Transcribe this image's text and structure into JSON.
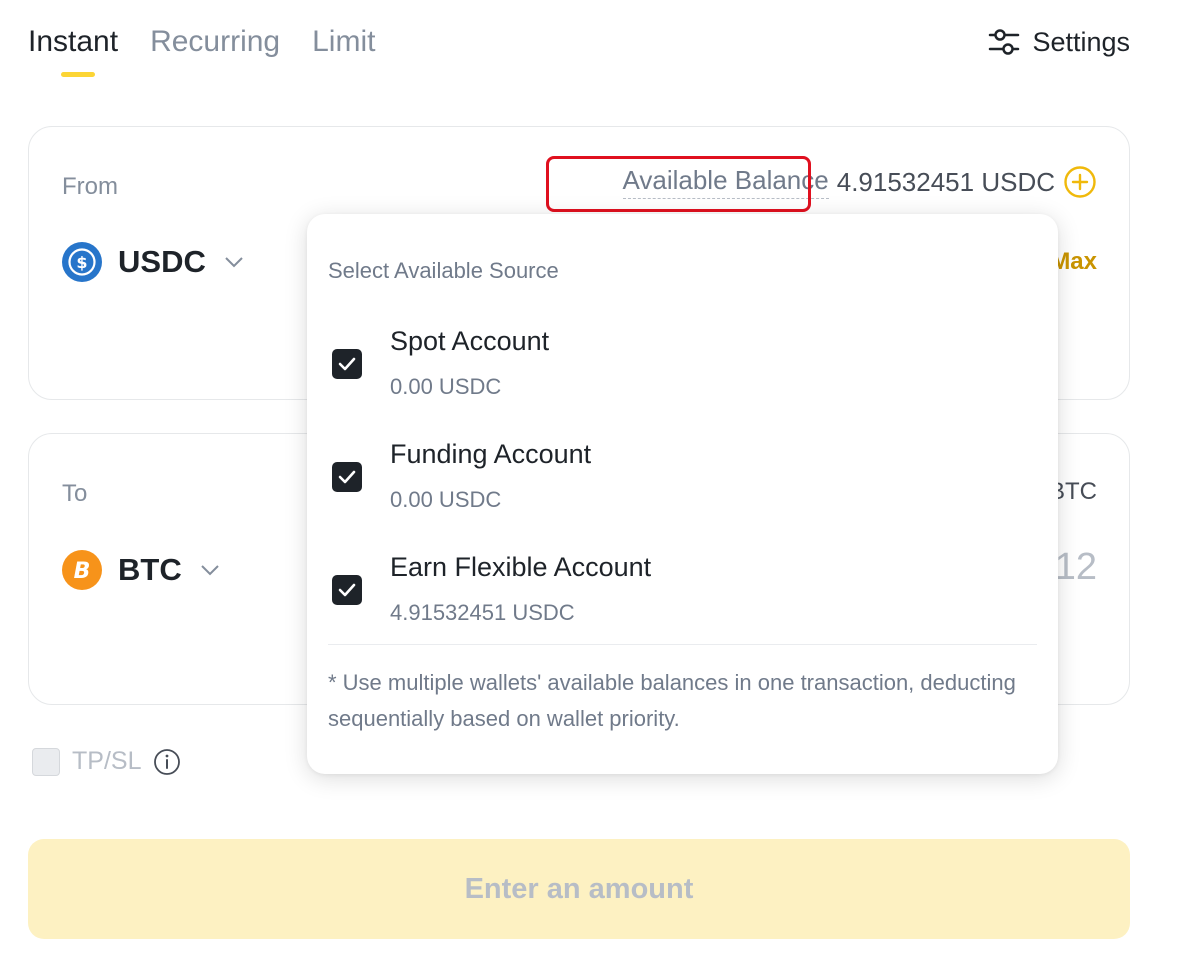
{
  "tabs": [
    {
      "label": "Instant",
      "active": true
    },
    {
      "label": "Recurring",
      "active": false
    },
    {
      "label": "Limit",
      "active": false
    }
  ],
  "settings": {
    "label": "Settings",
    "icon": "sliders-icon"
  },
  "from": {
    "label": "From",
    "coin": "USDC",
    "available_label": "Available Balance",
    "available_value": "4.91532451 USDC",
    "max_label": "Max"
  },
  "to": {
    "label": "To",
    "coin": "BTC",
    "right_top": "BTC",
    "right_value": "12"
  },
  "tpsl": {
    "label": "TP/SL"
  },
  "enter_button": {
    "label": "Enter an amount"
  },
  "popover": {
    "title": "Select Available Source",
    "sources": [
      {
        "name": "Spot Account",
        "balance": "0.00 USDC",
        "checked": true
      },
      {
        "name": "Funding Account",
        "balance": "0.00 USDC",
        "checked": true
      },
      {
        "name": "Earn Flexible Account",
        "balance": "4.91532451 USDC",
        "checked": true
      }
    ],
    "note": "* Use multiple wallets' available balances in one transaction, deducting sequentially based on wallet priority."
  },
  "colors": {
    "accent_yellow": "#fcd535",
    "max_gold": "#c99400",
    "highlight_red": "#e0101f",
    "usdc_blue": "#2775ca",
    "btc_orange": "#f7931a",
    "button_disabled": "#fdf1c2"
  }
}
